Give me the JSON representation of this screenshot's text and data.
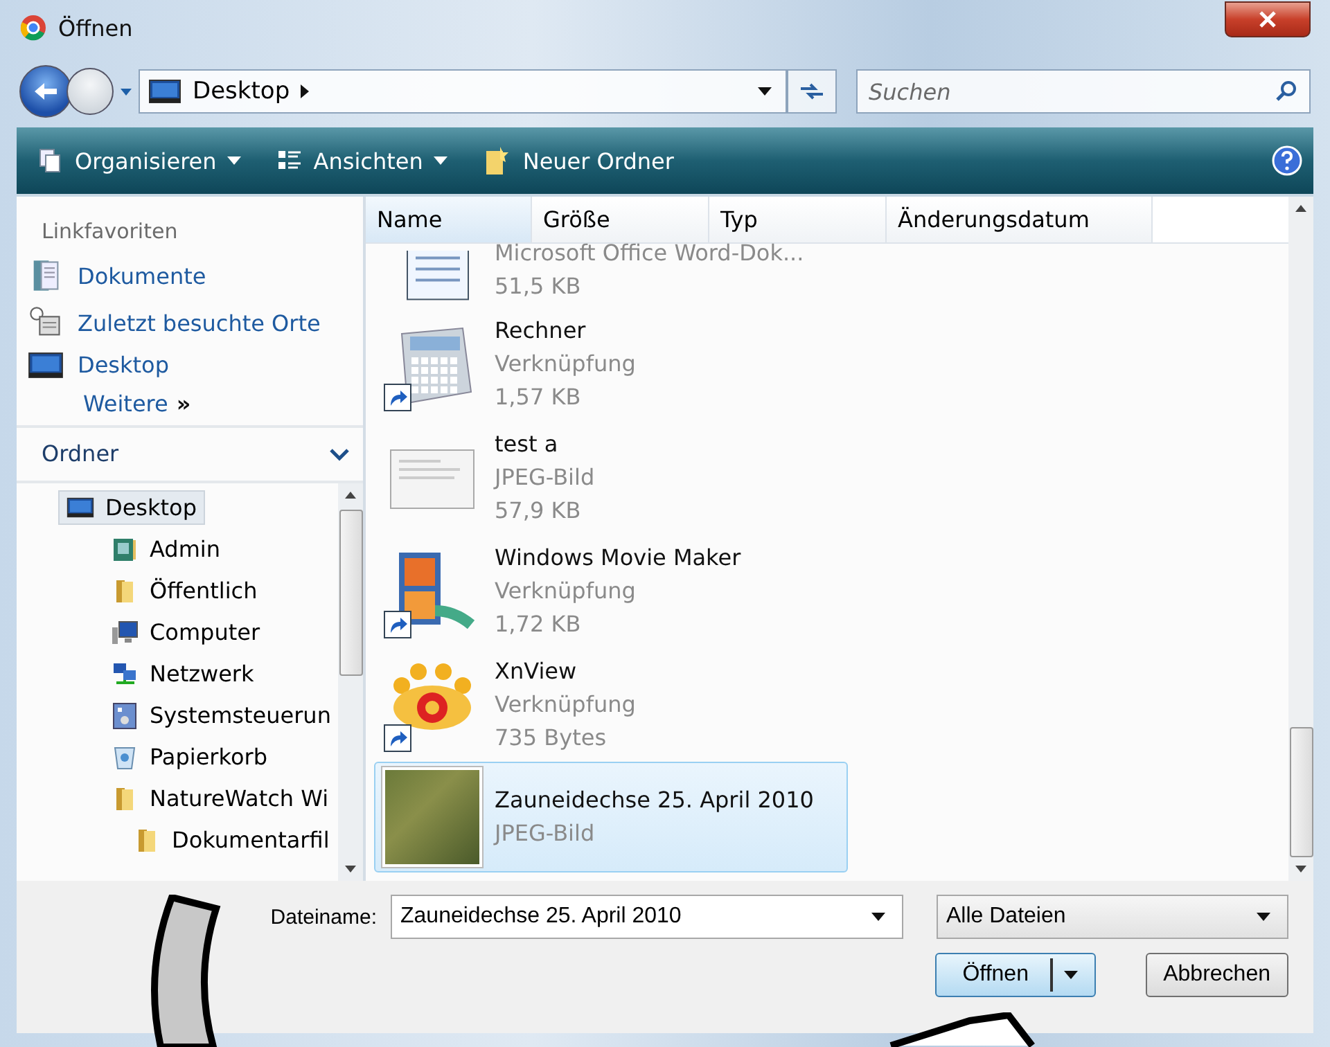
{
  "window": {
    "title": "Öffnen"
  },
  "address": {
    "location": "Desktop",
    "search_placeholder": "Suchen"
  },
  "toolbar": {
    "items": [
      {
        "kind": "organize",
        "label": "Organisieren",
        "dropdown": true
      },
      {
        "kind": "views",
        "label": "Ansichten",
        "dropdown": true
      },
      {
        "kind": "new-folder",
        "label": "Neuer Ordner",
        "dropdown": false
      }
    ]
  },
  "favorites": {
    "heading": "Linkfavoriten",
    "items": [
      {
        "kind": "documents",
        "label": "Dokumente"
      },
      {
        "kind": "recent",
        "label": "Zuletzt besuchte Orte"
      },
      {
        "kind": "desktop",
        "label": "Desktop"
      }
    ],
    "more": "Weitere",
    "more_glyph": "»"
  },
  "folders": {
    "heading": "Ordner",
    "expanded": true,
    "tree": [
      {
        "kind": "desktop",
        "label": "Desktop",
        "selected": true,
        "children": [
          {
            "kind": "user",
            "label": "Admin",
            "selected": false
          },
          {
            "kind": "folder",
            "label": "Öffentlich",
            "selected": false
          },
          {
            "kind": "computer",
            "label": "Computer",
            "selected": false
          },
          {
            "kind": "network",
            "label": "Netzwerk",
            "selected": false
          },
          {
            "kind": "control-panel",
            "label": "Systemsteuerun",
            "selected": false
          },
          {
            "kind": "recycle-bin",
            "label": "Papierkorb",
            "selected": false
          },
          {
            "kind": "folder",
            "label": "NatureWatch Wi",
            "selected": false,
            "children": [
              {
                "kind": "folder",
                "label": "Dokumentarfil",
                "selected": false
              }
            ]
          }
        ]
      }
    ]
  },
  "table": {
    "columns": [
      "Name",
      "Größe",
      "Typ",
      "Änderungsdatum"
    ],
    "files": [
      {
        "kind": "word-doc",
        "type": "Microsoft Office Word-Dok...",
        "size": "51,5 KB",
        "shortcut": false,
        "selected": false
      },
      {
        "kind": "calculator",
        "name": "Rechner",
        "type": "Verknüpfung",
        "size": "1,57 KB",
        "shortcut": true,
        "selected": false
      },
      {
        "kind": "screenshot",
        "name": "test a",
        "type": "JPEG-Bild",
        "size": "57,9 KB",
        "shortcut": false,
        "selected": false
      },
      {
        "kind": "movie",
        "name": "Windows Movie Maker",
        "type": "Verknüpfung",
        "size": "1,72 KB",
        "shortcut": true,
        "selected": false
      },
      {
        "kind": "eye",
        "name": "XnView",
        "type": "Verknüpfung",
        "size": "735 Bytes",
        "shortcut": true,
        "selected": false
      },
      {
        "kind": "photo",
        "name": "Zauneidechse 25. April 2010",
        "type": "JPEG-Bild",
        "shortcut": false,
        "selected": true
      }
    ]
  },
  "footer": {
    "filename_label": "Dateiname:",
    "filename": "Zauneidechse 25. April 2010",
    "filter": "Alle Dateien",
    "open": "Öffnen",
    "cancel": "Abbrechen"
  }
}
